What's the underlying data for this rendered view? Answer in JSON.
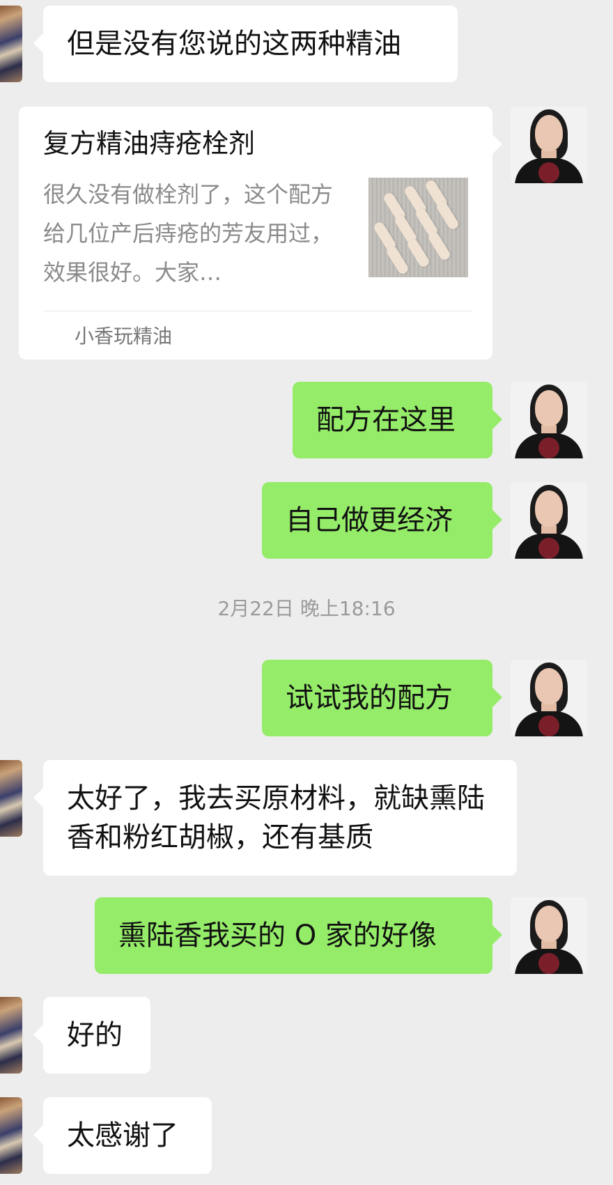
{
  "messages": [
    {
      "text": "但是没有您说的这两种精油"
    },
    {
      "text": "配方在这里"
    },
    {
      "text": "自己做更经济"
    },
    {
      "text": "试试我的配方"
    },
    {
      "text": "太好了，我去买原材料，就缺熏陆香和粉红胡椒，还有基质"
    },
    {
      "text": "熏陆香我买的 O 家的好像"
    },
    {
      "text": "好的"
    },
    {
      "text": "太感谢了"
    }
  ],
  "link_card": {
    "title": "复方精油痔疮栓剂",
    "description": "很久没有做栓剂了，这个配方给几位产后痔疮的芳友用过，效果很好。大家…",
    "source": "小香玩精油"
  },
  "timestamp": "2月22日 晚上18:16",
  "colors": {
    "background": "#ededed",
    "incoming_bubble": "#ffffff",
    "outgoing_bubble": "#95ec69",
    "timestamp_text": "#9a9a9a"
  }
}
